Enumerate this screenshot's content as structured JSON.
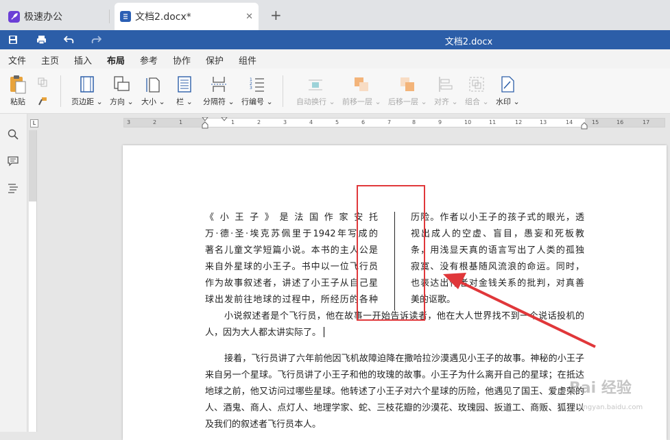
{
  "tabs": {
    "app_tab": "极速办公",
    "doc_tab": "文档2.docx*",
    "close_glyph": "✕",
    "new_tab_glyph": "+"
  },
  "titlebar": {
    "title": "文档2.docx"
  },
  "menu": [
    "文件",
    "主页",
    "插入",
    "布局",
    "参考",
    "协作",
    "保护",
    "组件"
  ],
  "ribbon": {
    "paste": "粘贴",
    "margins": "页边距",
    "orientation": "方向",
    "size": "大小",
    "columns": "栏",
    "breaks": "分隔符",
    "line_numbers": "行编号",
    "wrap": "自动换行",
    "bring_forward": "前移一层",
    "send_backward": "后移一层",
    "align": "对齐",
    "group": "组合",
    "watermark": "水印"
  },
  "ruler": {
    "numbers": [
      "3",
      "2",
      "1",
      "1",
      "2",
      "3",
      "4",
      "5",
      "6",
      "7",
      "8",
      "9",
      "10",
      "11",
      "12",
      "13",
      "14",
      "15",
      "16",
      "17"
    ]
  },
  "document": {
    "col_left": [
      "《小王子》是法国作家安托",
      "万·德·圣·埃克苏佩里于1942年写成的",
      "著名儿童文学短篇小说。本书的主人公是",
      "来自外星球的小王子。书中以一位飞行员",
      "作为故事叙述者，讲述了小王子从自己星",
      "球出发前往地球的过程中，所经历的各种"
    ],
    "col_right": [
      "历险。作者以小王子的孩子式的眼光，透",
      "视出成人的空虚、盲目，愚妄和死板教",
      "条，用浅显天真的语言写出了人类的孤独",
      "寂寞、没有根基随风流浪的命运。同时，",
      "也表达出作者对金钱关系的批判，对真善",
      "美的讴歌。"
    ],
    "para2": "小说叙述者是个飞行员，他在故事一开始告诉读者，他在大人世界找不到一个说话投机的人，因为大人都太讲实际了。",
    "para3": "接着，飞行员讲了六年前他因飞机故障迫降在撒哈拉沙漠遇见小王子的故事。神秘的小王子来自另一个星球。飞行员讲了小王子和他的玫瑰的故事。小王子为什么离开自己的星球；在抵达地球之前，他又访问过哪些星球。他转述了小王子对六个星球的历险，他遇见了国王、爱虚荣的人、酒鬼、商人、点灯人、地理学家、蛇、三枝花瓣的沙漠花、玫瑰园、扳道工、商贩、狐狸以及我们的叙述者飞行员本人。"
  },
  "watermark": {
    "text": "Bai 经验",
    "sub": "jingyan.baidu.com"
  },
  "colors": {
    "accent": "#2c5ea8",
    "highlight": "#e0373a"
  }
}
